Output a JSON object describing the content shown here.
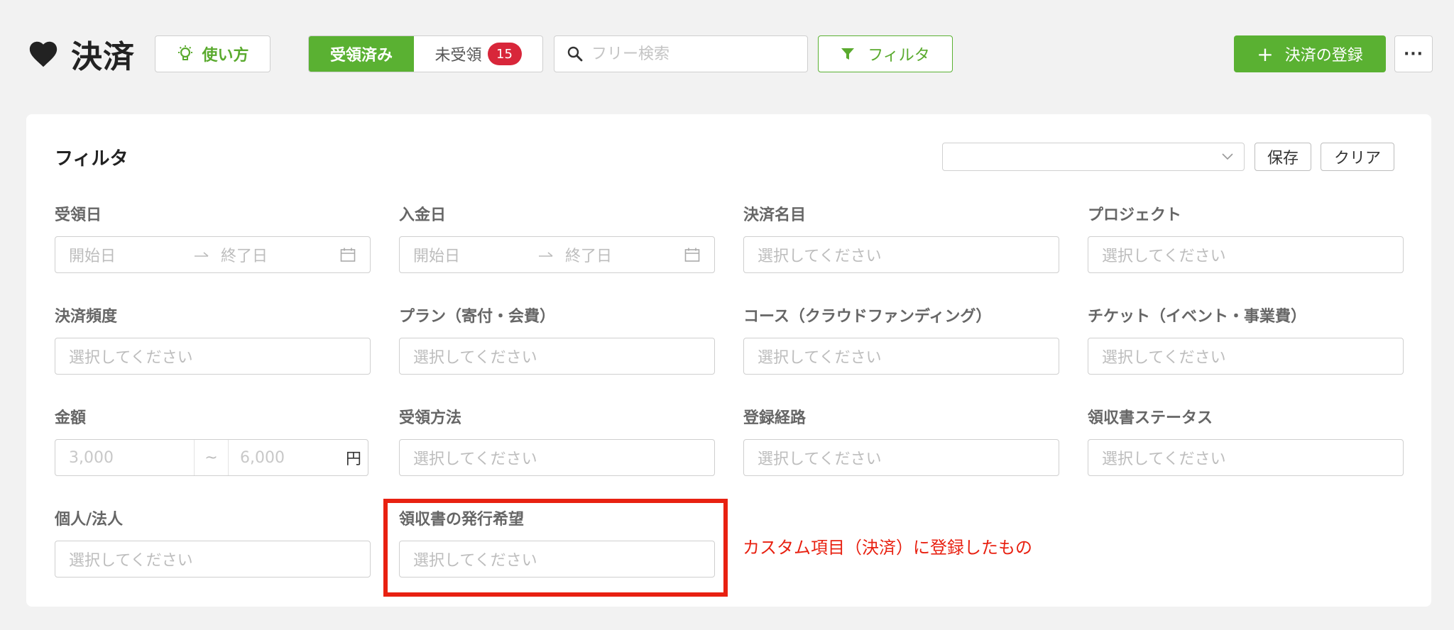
{
  "header": {
    "title": "決済",
    "howto_label": "使い方",
    "tabs": [
      {
        "label": "受領済み",
        "active": true
      },
      {
        "label": "未受領",
        "badge": "15",
        "active": false
      }
    ],
    "search_placeholder": "フリー検索",
    "filter_label": "フィルタ",
    "register_label": "決済の登録",
    "more_label": "···"
  },
  "colors": {
    "accent_green": "#5ab132",
    "badge_red": "#d8263a",
    "annotation_red": "#e82111"
  },
  "filter_panel": {
    "title": "フィルタ",
    "preset_value": "",
    "save_label": "保存",
    "clear_label": "クリア",
    "fields": {
      "received_date": {
        "label": "受領日",
        "start_placeholder": "開始日",
        "end_placeholder": "終了日"
      },
      "deposit_date": {
        "label": "入金日",
        "start_placeholder": "開始日",
        "end_placeholder": "終了日"
      },
      "payment_name": {
        "label": "決済名目",
        "placeholder": "選択してください"
      },
      "project": {
        "label": "プロジェクト",
        "placeholder": "選択してください"
      },
      "payment_frequency": {
        "label": "決済頻度",
        "placeholder": "選択してください"
      },
      "plan": {
        "label": "プラン（寄付・会費）",
        "placeholder": "選択してください"
      },
      "course": {
        "label": "コース（クラウドファンディング）",
        "placeholder": "選択してください"
      },
      "ticket": {
        "label": "チケット（イベント・事業費）",
        "placeholder": "選択してください"
      },
      "amount": {
        "label": "金額",
        "min_placeholder": "3,000",
        "separator": "~",
        "max_placeholder": "6,000",
        "unit": "円"
      },
      "receipt_method": {
        "label": "受領方法",
        "placeholder": "選択してください"
      },
      "registration_route": {
        "label": "登録経路",
        "placeholder": "選択してください"
      },
      "receipt_status": {
        "label": "領収書ステータス",
        "placeholder": "選択してください"
      },
      "individual_corporate": {
        "label": "個人/法人",
        "placeholder": "選択してください"
      },
      "receipt_request": {
        "label": "領収書の発行希望",
        "placeholder": "選択してください"
      }
    }
  },
  "annotation": {
    "text": "カスタム項目（決済）に登録したもの"
  }
}
